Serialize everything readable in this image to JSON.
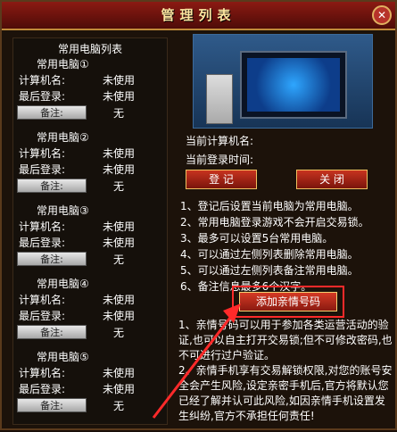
{
  "window": {
    "title": "管理列表",
    "close_icon": "close-icon"
  },
  "left_panel": {
    "title": "常用电脑列表",
    "computers": [
      {
        "name": "常用电脑①",
        "pc_label": "计算机名:",
        "pc_value": "未使用",
        "login_label": "最后登录:",
        "login_value": "未使用",
        "note_button": "备注:",
        "note_value": "无"
      },
      {
        "name": "常用电脑②",
        "pc_label": "计算机名:",
        "pc_value": "未使用",
        "login_label": "最后登录:",
        "login_value": "未使用",
        "note_button": "备注:",
        "note_value": "无"
      },
      {
        "name": "常用电脑③",
        "pc_label": "计算机名:",
        "pc_value": "未使用",
        "login_label": "最后登录:",
        "login_value": "未使用",
        "note_button": "备注:",
        "note_value": "无"
      },
      {
        "name": "常用电脑④",
        "pc_label": "计算机名:",
        "pc_value": "未使用",
        "login_label": "最后登录:",
        "login_value": "未使用",
        "note_button": "备注:",
        "note_value": "无"
      },
      {
        "name": "常用电脑⑤",
        "pc_label": "计算机名:",
        "pc_value": "未使用",
        "login_label": "最后登录:",
        "login_value": "未使用",
        "note_button": "备注:",
        "note_value": "无"
      }
    ]
  },
  "right_panel": {
    "current_pc_label": "当前计算机名:",
    "current_login_label": "当前登录时间:",
    "register_button": "登 记",
    "close_button": "关 闭",
    "rules": [
      "1、登记后设置当前电脑为常用电脑。",
      "2、常用电脑登录游戏不会开启交易锁。",
      "3、最多可以设置5台常用电脑。",
      "4、可以通过左侧列表删除常用电脑。",
      "5、可以通过左侧列表备注常用电脑。",
      "6、备注信息最多6个汉字。"
    ],
    "add_family_button": "添加亲情号码",
    "desc1": "1、亲情号码可以用于参加各类运营活动的验证,也可以自主打开交易锁;但不可修改密码,也不可进行过户验证。",
    "desc2": "2、亲情手机享有交易解锁权限,对您的账号安全会产生风险,设定亲密手机后,官方将默认您已经了解并认可此风险,如因亲情手机设置发生纠纷,官方不承担任何责任!"
  },
  "colors": {
    "accent": "#c8331f",
    "highlight": "#ff2a2a",
    "title": "#fde6a0"
  }
}
